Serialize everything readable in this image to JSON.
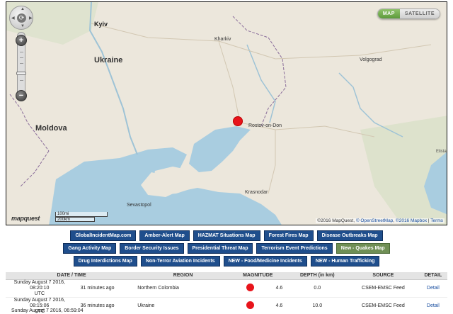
{
  "map": {
    "type_toggle": {
      "map_label": "MAP",
      "satellite_label": "SATELLITE",
      "selected": "MAP"
    },
    "labels": {
      "countries": [
        "Ukraine",
        "Moldova"
      ],
      "cities": [
        "Kyiv",
        "Kharkiv",
        "Volgograd",
        "Rostov-on-Don",
        "Krasnodar",
        "Sevastopol"
      ],
      "minor": [
        "Elista"
      ]
    },
    "scale": {
      "line1": "100mi",
      "line2": "200km"
    },
    "logo": "mapquest",
    "attribution": {
      "prefix": "©2016 MapQuest, ",
      "osm": "© OpenStreetMap",
      "mid": ", ",
      "mapbox": "©2016 Mapbox",
      "sep": " | ",
      "terms": "Terms"
    },
    "colors": {
      "land": "#ece7dc",
      "sea": "#a9cde0",
      "marker": "#e8141b"
    }
  },
  "nav": {
    "rows": [
      [
        "GlobalIncidentMap.com",
        "Amber-Alert Map",
        "HAZMAT Situations Map",
        "Forest Fires Map",
        "Disease Outbreaks Map"
      ],
      [
        "Gang Activity Map",
        "Border Security Issues",
        "Presidential Threat Map",
        "Terrorism Event Predictions",
        "New - Quakes Map"
      ],
      [
        "Drug Interdictions Map",
        "Non-Terror Aviation Incidents",
        "NEW - Food/Medicine Incidents",
        "NEW - Human Trafficking"
      ]
    ],
    "active": "New - Quakes Map",
    "colors": {
      "button": "#1f4e8c",
      "active": "#6f8f55"
    }
  },
  "table": {
    "headers": {
      "datetime": "DATE / TIME",
      "region": "REGION",
      "magnitude": "MAGNITUDE",
      "depth": "DEPTH (in km)",
      "source": "SOURCE",
      "detail": "DETAIL"
    },
    "rows": [
      {
        "date": "Sunday August 7 2016, 08:20:10",
        "tz": "UTC",
        "ago": "31 minutes ago",
        "region": "Northern Colombia",
        "magnitude": "4.6",
        "depth": "0.0",
        "source": "CSEM-EMSC Feed",
        "detail": "Detail"
      },
      {
        "date": "Sunday August 7 2016, 08:15:06",
        "tz": "UTC",
        "ago": "36 minutes ago",
        "region": "Ukraine",
        "magnitude": "4.6",
        "depth": "10.0",
        "source": "CSEM-EMSC Feed",
        "detail": "Detail"
      }
    ],
    "partial_row": "Sunday August 7 2016, 06:59:04"
  }
}
